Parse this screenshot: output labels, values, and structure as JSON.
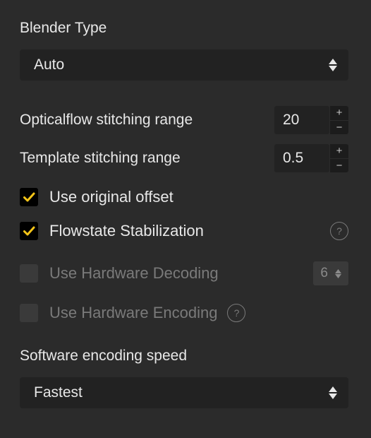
{
  "blenderType": {
    "heading": "Blender Type",
    "value": "Auto"
  },
  "opticalflow": {
    "label": "Opticalflow stitching range",
    "value": "20"
  },
  "template": {
    "label": "Template stitching range",
    "value": "0.5"
  },
  "useOriginalOffset": {
    "label": "Use original offset",
    "checked": true
  },
  "flowstate": {
    "label": "Flowstate Stabilization",
    "checked": true
  },
  "hwDecoding": {
    "label": "Use Hardware Decoding",
    "checked": false,
    "value": "6"
  },
  "hwEncoding": {
    "label": "Use Hardware Encoding",
    "checked": false
  },
  "encodingSpeed": {
    "heading": "Software encoding speed",
    "value": "Fastest"
  },
  "glyphs": {
    "plus": "+",
    "minus": "−",
    "help": "?"
  }
}
